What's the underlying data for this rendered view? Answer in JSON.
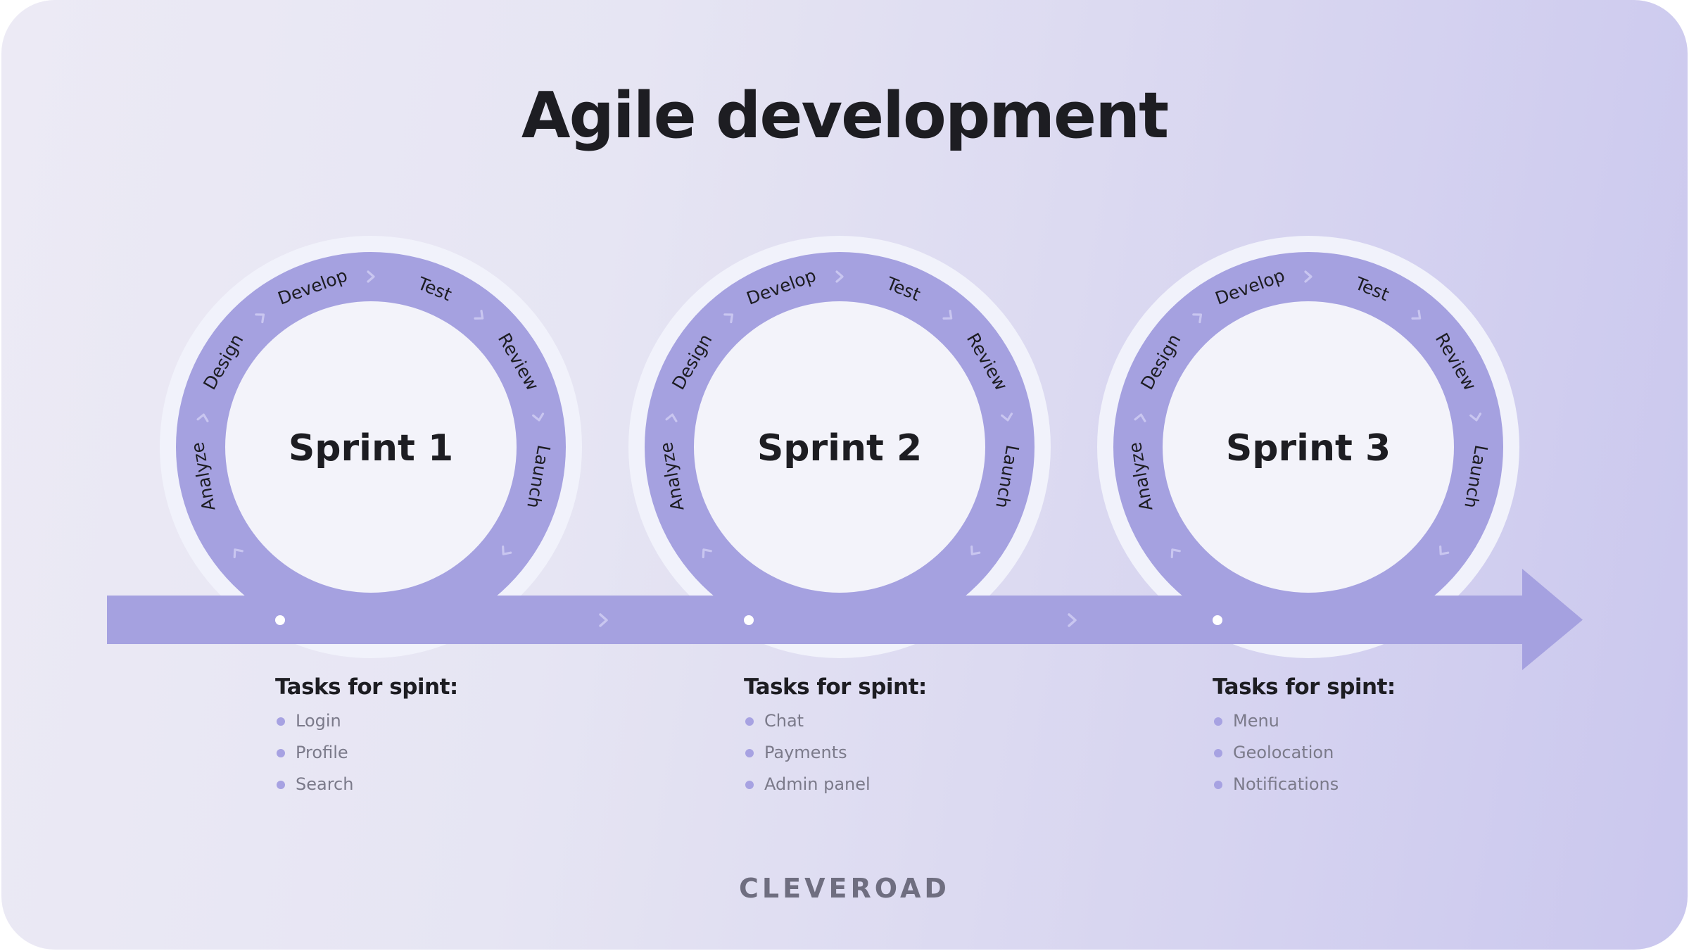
{
  "title": "Agile development",
  "colors": {
    "ring": "#a5a1e0",
    "halo": "#f1f2fb",
    "center": "#f3f3fa",
    "chevron": "#c9c6f0",
    "dot": "#ffffff",
    "text_dark": "#1d1d22",
    "task_text": "#7b7a8a",
    "bullet": "#a7a2e2",
    "logo": "#6f6e80"
  },
  "cycle_stages": [
    "Analyze",
    "Design",
    "Develop",
    "Test",
    "Review",
    "Launch"
  ],
  "sprints": [
    {
      "label": "Sprint 1",
      "tasks_heading": "Tasks for spint:",
      "tasks": [
        "Login",
        "Profile",
        "Search"
      ]
    },
    {
      "label": "Sprint 2",
      "tasks_heading": "Tasks for spint:",
      "tasks": [
        "Chat",
        "Payments",
        "Admin panel"
      ]
    },
    {
      "label": "Sprint 3",
      "tasks_heading": "Tasks for spint:",
      "tasks": [
        "Menu",
        "Geolocation",
        "Notifications"
      ]
    }
  ],
  "icons": {
    "timeline_arrow": "arrow-right-icon",
    "stage_separator": "chevron-icon",
    "sprint_start": "dot-icon"
  },
  "logo": "CLEVEROAD"
}
